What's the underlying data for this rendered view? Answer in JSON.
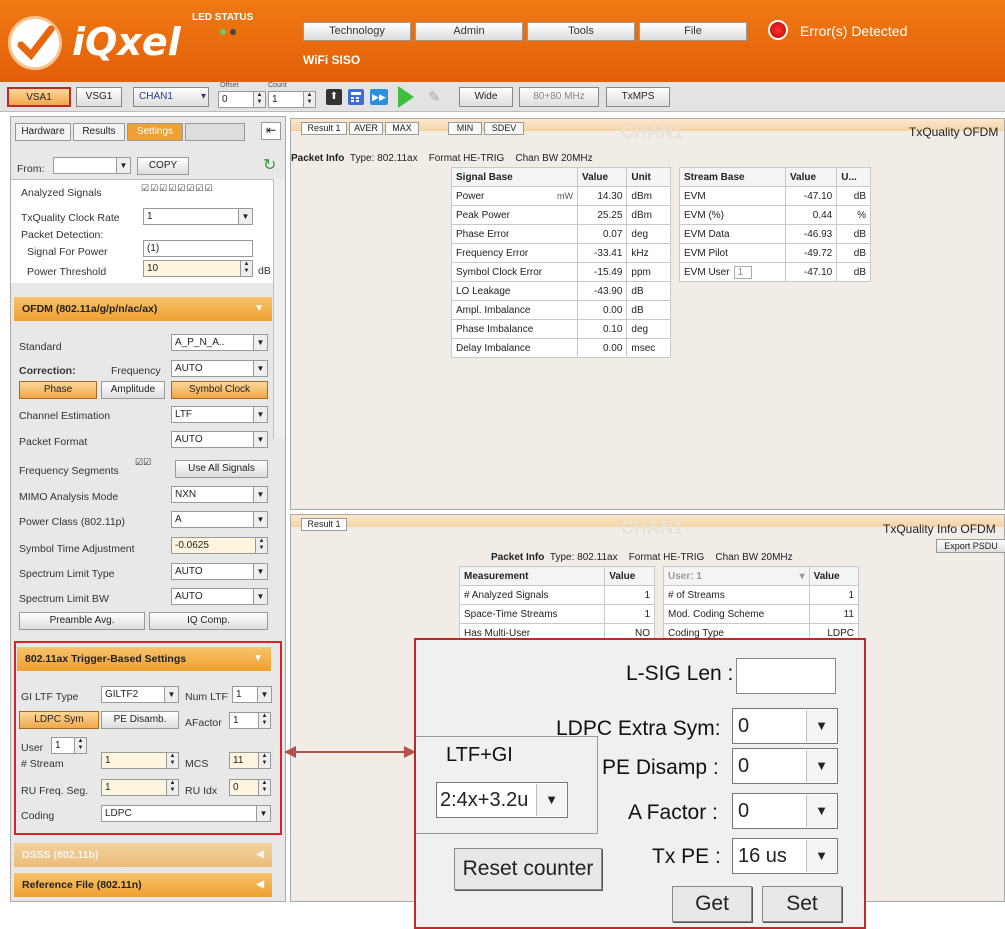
{
  "header": {
    "logo": "iQxel",
    "led_status_label": "LED STATUS",
    "nav": [
      "Technology",
      "Admin",
      "Tools",
      "File"
    ],
    "error_text": "Error(s) Detected",
    "mode": "WiFi SISO"
  },
  "toolbar": {
    "vsa": "VSA1",
    "vsg": "VSG1",
    "chan": "CHAN1",
    "offset_label": "Offset",
    "count_label": "Count",
    "offset": "0",
    "count": "1",
    "wide": "Wide",
    "bw": "80+80 MHz",
    "txmps": "TxMPS"
  },
  "left": {
    "tabs": [
      "Hardware",
      "Results",
      "Settings"
    ],
    "from_label": "From:",
    "copy": "COPY",
    "analyzed_signals": "Analyzed Signals",
    "clock_rate_label": "TxQuality Clock Rate",
    "clock_rate": "1",
    "packet_detection": "Packet Detection:",
    "signal_for_power": "Signal For Power",
    "signal_for_power_val": "(1)",
    "power_threshold": "Power Threshold",
    "power_threshold_val": "10",
    "db": "dB",
    "ofdm_section": "OFDM (802.11a/g/p/n/ac/ax)",
    "standard": "Standard",
    "standard_val": "A_P_N_A..",
    "correction": "Correction:",
    "frequency": "Frequency",
    "frequency_val": "AUTO",
    "phase": "Phase",
    "amplitude": "Amplitude",
    "symbol_clock": "Symbol Clock",
    "channel_estimation": "Channel Estimation",
    "channel_estimation_val": "LTF",
    "packet_format": "Packet Format",
    "packet_format_val": "AUTO",
    "freq_segments": "Frequency Segments",
    "use_all": "Use All Signals",
    "mimo_mode": "MIMO Analysis Mode",
    "mimo_val": "NXN",
    "power_class": "Power Class (802.11p)",
    "power_class_val": "A",
    "symbol_time": "Symbol Time Adjustment",
    "symbol_time_val": "-0.0625",
    "spec_limit_type": "Spectrum Limit Type",
    "spec_limit_type_val": "AUTO",
    "spec_limit_bw": "Spectrum Limit BW",
    "spec_limit_bw_val": "AUTO",
    "preamble_avg": "Preamble Avg.",
    "iq_comp": "IQ Comp.",
    "trigger_section": "802.11ax Trigger-Based Settings",
    "gi_ltf_type": "GI LTF Type",
    "gi_ltf_val": "GILTF2",
    "num_ltf": "Num LTF",
    "num_ltf_val": "1",
    "ldpc_sym": "LDPC Sym",
    "pe_disamb": "PE Disamb.",
    "afactor": "AFactor",
    "afactor_val": "1",
    "user": "User",
    "user_val": "1",
    "stream": "# Stream",
    "stream_val": "1",
    "mcs": "MCS",
    "mcs_val": "11",
    "ru_freq": "RU Freq. Seg.",
    "ru_freq_val": "1",
    "ru_idx": "RU Idx",
    "ru_idx_val": "0",
    "coding": "Coding",
    "coding_val": "LDPC",
    "dsss_section": "DSSS (802.11b)",
    "ref_section": "Reference File (802.11n)"
  },
  "top_panel": {
    "tabs": [
      "Result 1",
      "AVER",
      "MAX",
      "MIN",
      "SDEV"
    ],
    "title": "TxQuality OFDM",
    "watermark": "CHAN1",
    "packet_info": "Packet Info",
    "type": "Type: 802.11ax",
    "format": "Format HE-TRIG",
    "chan_bw": "Chan BW 20MHz",
    "signal_headers": [
      "Signal Base",
      "Value",
      "Unit"
    ],
    "signal_rows": [
      [
        "Power",
        "14.30",
        "dBm"
      ],
      [
        "Peak Power",
        "25.25",
        "dBm"
      ],
      [
        "Phase Error",
        "0.07",
        "deg"
      ],
      [
        "Frequency Error",
        "-33.41",
        "kHz"
      ],
      [
        "Symbol Clock Error",
        "-15.49",
        "ppm"
      ],
      [
        "LO Leakage",
        "-43.90",
        "dB"
      ],
      [
        "Ampl. Imbalance",
        "0.00",
        "dB"
      ],
      [
        "Phase Imbalance",
        "0.10",
        "deg"
      ],
      [
        "Delay Imbalance",
        "0.00",
        "msec"
      ]
    ],
    "mw": "mW",
    "stream_headers": [
      "Stream Base",
      "Value",
      "U..."
    ],
    "stream_rows": [
      [
        "EVM",
        "-47.10",
        "dB"
      ],
      [
        "EVM (%)",
        "0.44",
        "%"
      ],
      [
        "EVM Data",
        "-46.93",
        "dB"
      ],
      [
        "EVM Pilot",
        "-49.72",
        "dB"
      ],
      [
        "EVM User",
        "-47.10",
        "dB"
      ]
    ],
    "evm_user_sel": "1"
  },
  "bottom_panel": {
    "tab": "Result 1",
    "title": "TxQuality Info OFDM",
    "export": "Export PSDU",
    "watermark": "CHAN1",
    "packet_info": "Packet Info",
    "type": "Type: 802.11ax",
    "format": "Format HE-TRIG",
    "chan_bw": "Chan BW 20MHz",
    "m_headers": [
      "Measurement",
      "Value"
    ],
    "m_rows": [
      [
        "# Analyzed Signals",
        "1"
      ],
      [
        "Space-Time Streams",
        "1"
      ],
      [
        "Has Multi-User",
        "NO"
      ]
    ],
    "u_headers": [
      "User:",
      "1",
      "Value"
    ],
    "u_rows": [
      [
        "# of Streams",
        "1"
      ],
      [
        "Mod. Coding Scheme",
        "11"
      ],
      [
        "Coding Type",
        "LDPC"
      ]
    ]
  },
  "zoom": {
    "lsig_len": "L-SIG Len :",
    "ltf_gi": "LTF+GI",
    "ltf_gi_val": "2:4x+3.2u",
    "ldpc_extra": "LDPC Extra Sym:",
    "ldpc_extra_val": "0",
    "pe_disamp": "PE Disamp :",
    "pe_disamp_val": "0",
    "a_factor": "A Factor :",
    "a_factor_val": "0",
    "tx_pe": "Tx PE :",
    "tx_pe_val": "16 us",
    "reset": "Reset counter",
    "get": "Get",
    "set": "Set"
  },
  "colors": {
    "header": "#ea6a0e",
    "highlight": "#c0282d",
    "section": "#f0a030"
  }
}
